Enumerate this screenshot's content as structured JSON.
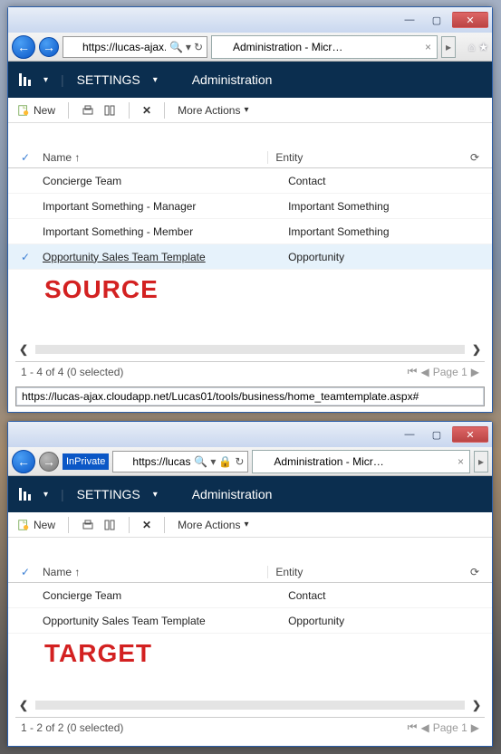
{
  "topWindow": {
    "titlebar": {
      "min": "—",
      "max": "▢",
      "close": "✕"
    },
    "ie": {
      "url": "https://lucas-ajax.cl…",
      "searchGlyph": "🔍",
      "refreshGlyph": "↻",
      "tabTitle": "Administration - Micr…",
      "tabClose": "×",
      "homeGlyph": "⌂",
      "starGlyph": "★"
    },
    "nav": {
      "settings": "SETTINGS",
      "page": "Administration"
    },
    "cmd": {
      "new": "New",
      "moreActions": "More Actions"
    },
    "grid": {
      "hdrName": "Name ↑",
      "hdrEntity": "Entity",
      "rows": [
        {
          "name": "Concierge Team",
          "entity": "Contact",
          "sel": false,
          "chk": ""
        },
        {
          "name": "Important Something - Manager",
          "entity": "Important Something",
          "sel": false,
          "chk": ""
        },
        {
          "name": "Important Something - Member",
          "entity": "Important Something",
          "sel": false,
          "chk": ""
        },
        {
          "name": "Opportunity Sales Team Template",
          "entity": "Opportunity",
          "sel": true,
          "chk": "✓"
        }
      ]
    },
    "annot": "SOURCE",
    "pager": {
      "status": "1 - 4 of 4 (0 selected)",
      "page": "Page 1"
    },
    "status": "https://lucas-ajax.cloudapp.net/Lucas01/tools/business/home_teamtemplate.aspx#"
  },
  "bottomWindow": {
    "titlebar": {
      "min": "—",
      "max": "▢",
      "close": "✕"
    },
    "ie": {
      "inprivate": "InPrivate",
      "url": "https://lucas-ajax.c",
      "tabTitle": "Administration - Micr…",
      "tabClose": "×"
    },
    "nav": {
      "settings": "SETTINGS",
      "page": "Administration"
    },
    "cmd": {
      "new": "New",
      "moreActions": "More Actions"
    },
    "grid": {
      "hdrName": "Name ↑",
      "hdrEntity": "Entity",
      "rows": [
        {
          "name": "Concierge Team",
          "entity": "Contact"
        },
        {
          "name": "Opportunity Sales Team Template",
          "entity": "Opportunity"
        }
      ]
    },
    "annot": "TARGET",
    "pager": {
      "status": "1 - 2 of 2 (0 selected)",
      "page": "Page 1"
    }
  }
}
